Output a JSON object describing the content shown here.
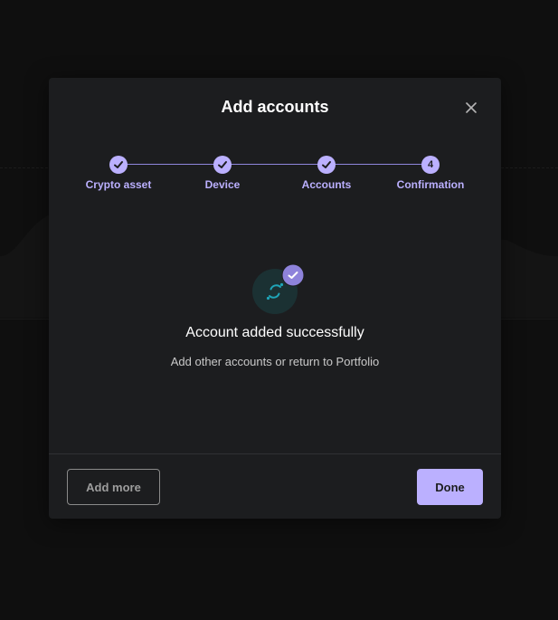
{
  "modal": {
    "title": "Add accounts",
    "close_icon": "close-icon"
  },
  "stepper": {
    "steps": [
      {
        "label": "Crypto asset",
        "status": "completed",
        "marker": "check-icon"
      },
      {
        "label": "Device",
        "status": "completed",
        "marker": "check-icon"
      },
      {
        "label": "Accounts",
        "status": "completed",
        "marker": "check-icon"
      },
      {
        "label": "Confirmation",
        "status": "current",
        "marker": "4"
      }
    ]
  },
  "result": {
    "asset_icon": "icon-crypto-logo-icon",
    "badge_icon": "check-icon",
    "title": "Account added successfully",
    "subtitle": "Add other accounts or return to Portfolio"
  },
  "footer": {
    "secondary_label": "Add more",
    "primary_label": "Done"
  },
  "colors": {
    "accent": "#bbb0ff",
    "modal_bg": "#1c1d1f",
    "page_bg": "#0f0f0f",
    "asset_color": "#1fa5b8"
  }
}
